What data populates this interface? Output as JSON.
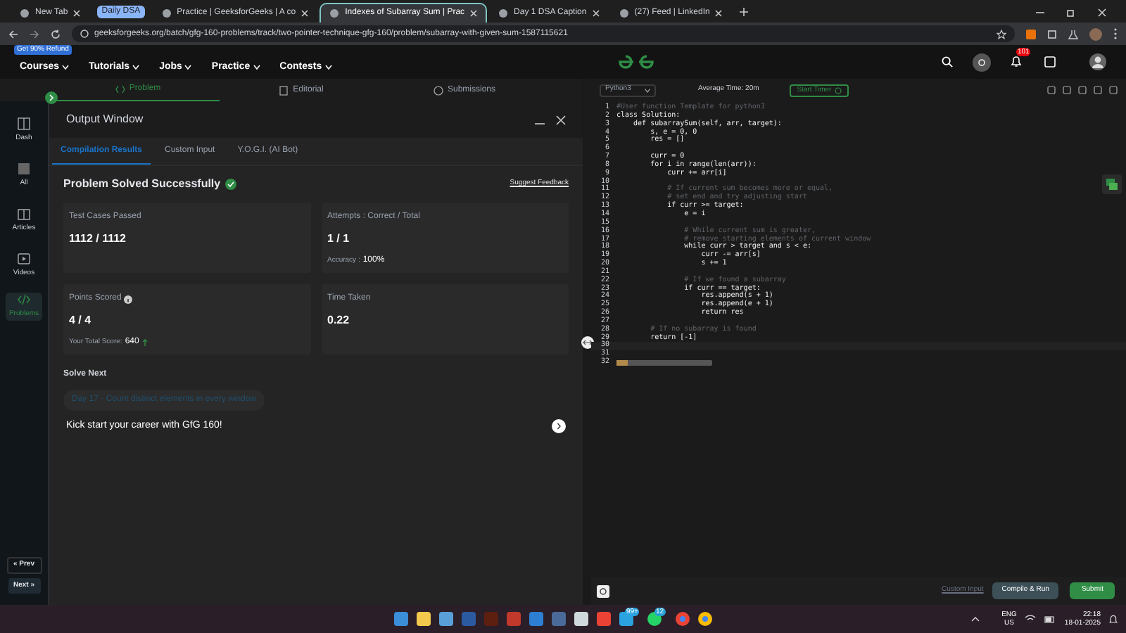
{
  "browser": {
    "tabs": [
      {
        "kind": "tab",
        "label": "New Tab",
        "selected": false
      },
      {
        "kind": "group",
        "label": "Daily DSA"
      },
      {
        "kind": "tab",
        "label": "Practice | GeeksforGeeks | A co",
        "selected": false
      },
      {
        "kind": "tab",
        "label": "Indexes of Subarray Sum | Prac",
        "selected": true
      },
      {
        "kind": "tab",
        "label": "Day 1 DSA Caption",
        "selected": false
      },
      {
        "kind": "tab",
        "label": "(27) Feed | LinkedIn",
        "selected": false
      }
    ],
    "address": "geeksforgeeks.org/batch/gfg-160-problems/track/two-pointer-technique-gfg-160/problem/subarray-with-given-sum-1587115621"
  },
  "nav": {
    "promo": "Get 90% Refund",
    "menus": [
      "Courses",
      "Tutorials",
      "Jobs",
      "Practice",
      "Contests"
    ],
    "notification_count": "101"
  },
  "problem_tabs": [
    {
      "label": "Problem",
      "selected": true
    },
    {
      "label": "Editorial",
      "selected": false
    },
    {
      "label": "Submissions",
      "selected": false
    }
  ],
  "sidebar": {
    "items": [
      {
        "label": "Dash",
        "selected": false
      },
      {
        "label": "All",
        "selected": false
      },
      {
        "label": "Articles",
        "selected": false
      },
      {
        "label": "Videos",
        "selected": false
      },
      {
        "label": "Problems",
        "selected": true
      }
    ],
    "prev": "« Prev",
    "next": "Next »"
  },
  "output": {
    "title": "Output Window",
    "tabs": [
      {
        "label": "Compilation Results",
        "selected": true
      },
      {
        "label": "Custom Input",
        "selected": false
      },
      {
        "label": "Y.O.G.I. (AI Bot)",
        "selected": false
      }
    ],
    "status": "Problem Solved Successfully",
    "feedback": "Suggest Feedback",
    "cards": [
      {
        "label": "Test Cases Passed",
        "value": "1112 / 1112"
      },
      {
        "label": "Attempts : Correct / Total",
        "value": "1 / 1",
        "note_label": "Accuracy :",
        "note_value": "100%"
      },
      {
        "label": "Points Scored",
        "value": "4 / 4",
        "note_label": "Your Total Score:",
        "note_value": "640",
        "info": true
      },
      {
        "label": "Time Taken",
        "value": "0.22"
      }
    ],
    "solve_next": "Solve Next",
    "next_problem": "Day 17 - Count distinct elements in every window",
    "promo": "Kick start your career with GfG 160!"
  },
  "editor": {
    "language": "Python3",
    "average_time": "Average Time: 20m",
    "timer": "Start Timer",
    "lines": [
      {
        "number": "1",
        "kind": "comment",
        "text": "#User function Template for python3"
      },
      {
        "number": "2",
        "kind": "code",
        "text": "class Solution:"
      },
      {
        "number": "3",
        "kind": "code",
        "text": "    def subarraySum(self, arr, target):"
      },
      {
        "number": "4",
        "kind": "code",
        "text": "        s, e = 0, 0"
      },
      {
        "number": "5",
        "kind": "code",
        "text": "        res = []"
      },
      {
        "number": "6",
        "kind": "blank"
      },
      {
        "number": "7",
        "kind": "code",
        "text": "        curr = 0"
      },
      {
        "number": "8",
        "kind": "code",
        "text": "        for i in range(len(arr)):"
      },
      {
        "number": "9",
        "kind": "code",
        "text": "            curr += arr[i]"
      },
      {
        "number": "10",
        "kind": "blank"
      },
      {
        "number": "11",
        "kind": "comment",
        "text": "            # If current sum becomes more or equal,"
      },
      {
        "number": "12",
        "kind": "comment",
        "text": "            # set end and try adjusting start"
      },
      {
        "number": "13",
        "kind": "code",
        "text": "            if curr >= target:"
      },
      {
        "number": "14",
        "kind": "code",
        "text": "                e = i"
      },
      {
        "number": "15",
        "kind": "blank"
      },
      {
        "number": "16",
        "kind": "comment",
        "text": "                # While current sum is greater,"
      },
      {
        "number": "17",
        "kind": "comment",
        "text": "                # remove starting elements of current window"
      },
      {
        "number": "18",
        "kind": "code",
        "text": "                while curr > target and s < e:"
      },
      {
        "number": "19",
        "kind": "code",
        "text": "                    curr -= arr[s]"
      },
      {
        "number": "20",
        "kind": "code",
        "text": "                    s += 1"
      },
      {
        "number": "21",
        "kind": "blank"
      },
      {
        "number": "22",
        "kind": "comment",
        "text": "                # If we found a subarray"
      },
      {
        "number": "23",
        "kind": "code",
        "text": "                if curr == target:"
      },
      {
        "number": "24",
        "kind": "code",
        "text": "                    res.append(s + 1)"
      },
      {
        "number": "25",
        "kind": "code",
        "text": "                    res.append(e + 1)"
      },
      {
        "number": "26",
        "kind": "code",
        "text": "                    return res"
      },
      {
        "number": "27",
        "kind": "blank"
      },
      {
        "number": "28",
        "kind": "comment",
        "text": "        # If no subarray is found"
      },
      {
        "number": "29",
        "kind": "code",
        "text": "        return [-1]"
      },
      {
        "number": "30",
        "kind": "blank"
      },
      {
        "number": "31",
        "kind": "blank"
      },
      {
        "number": "32",
        "kind": "folded"
      }
    ],
    "custom_input": "Custom Input",
    "compile": "Compile & Run",
    "submit": "Submit"
  },
  "taskbar": {
    "badges": [
      "99+",
      "12"
    ],
    "lang": "ENG",
    "region": "US",
    "time": "22:18",
    "date": "18-01-2025"
  }
}
